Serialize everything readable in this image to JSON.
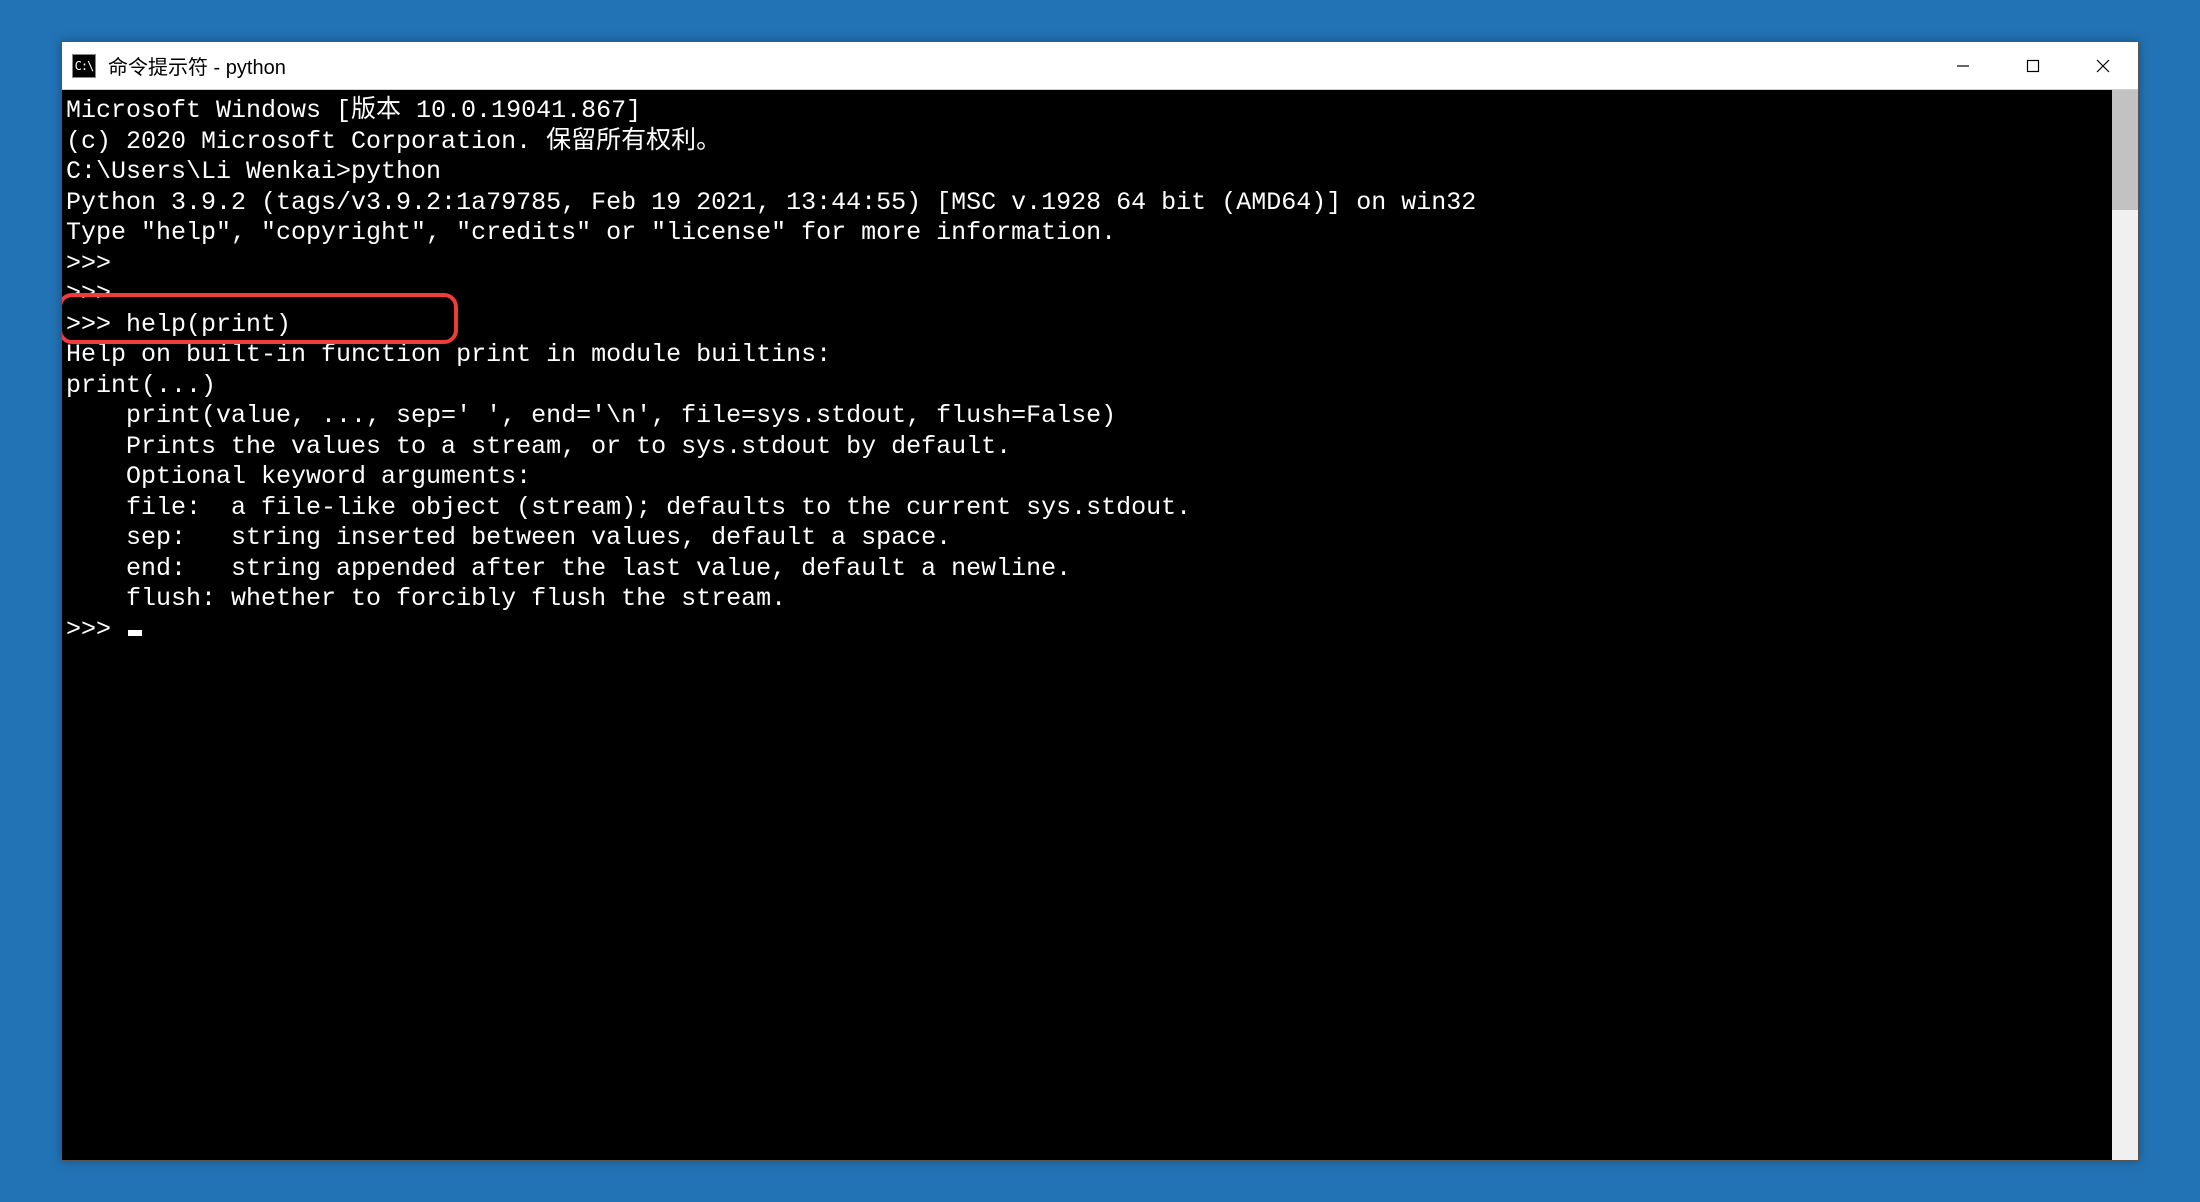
{
  "window": {
    "icon_label": "C:\\",
    "title": "命令提示符 - python"
  },
  "terminal": {
    "lines": [
      "Microsoft Windows [版本 10.0.19041.867]",
      "(c) 2020 Microsoft Corporation. 保留所有权利。",
      "",
      "C:\\Users\\Li Wenkai>python",
      "Python 3.9.2 (tags/v3.9.2:1a79785, Feb 19 2021, 13:44:55) [MSC v.1928 64 bit (AMD64)] on win32",
      "Type \"help\", \"copyright\", \"credits\" or \"license\" for more information.",
      ">>>",
      ">>>",
      ">>> help(print)",
      "Help on built-in function print in module builtins:",
      "",
      "print(...)",
      "    print(value, ..., sep=' ', end='\\n', file=sys.stdout, flush=False)",
      "",
      "    Prints the values to a stream, or to sys.stdout by default.",
      "    Optional keyword arguments:",
      "    file:  a file-like object (stream); defaults to the current sys.stdout.",
      "    sep:   string inserted between values, default a space.",
      "    end:   string appended after the last value, default a newline.",
      "    flush: whether to forcibly flush the stream.",
      "",
      ">>> "
    ],
    "highlight_line_index": 8,
    "cursor_after_last": true
  }
}
